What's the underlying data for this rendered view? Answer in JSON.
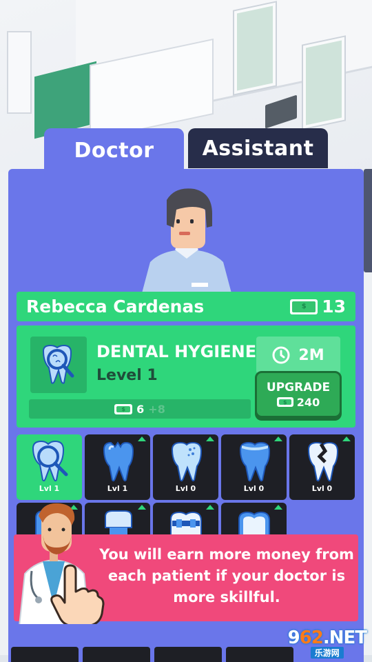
{
  "tabs": {
    "doctor": "Doctor",
    "assistant": "Assistant"
  },
  "doctor": {
    "name": "Rebecca Cardenas",
    "money": "13"
  },
  "skill": {
    "title": "DENTAL HYGIENE",
    "level": "Level 1",
    "time": "2M",
    "progress_value": "6",
    "progress_extra": "+8",
    "upgrade_label": "UPGRADE",
    "upgrade_cost": "240"
  },
  "skills_grid": [
    {
      "icon": "tooth-magnifier-icon",
      "level": "Lvl 1",
      "active": true
    },
    {
      "icon": "chipped-tooth-icon",
      "level": "Lvl 1",
      "active": false
    },
    {
      "icon": "cavity-tooth-icon",
      "level": "Lvl 0",
      "active": false
    },
    {
      "icon": "stained-tooth-icon",
      "level": "Lvl 0",
      "active": false
    },
    {
      "icon": "broken-tooth-icon",
      "level": "Lvl 0",
      "active": false
    },
    {
      "icon": "tooth-x-icon",
      "level": "",
      "active": false
    },
    {
      "icon": "crown-tooth-icon",
      "level": "",
      "active": false
    },
    {
      "icon": "braces-tooth-icon",
      "level": "",
      "active": false
    },
    {
      "icon": "tooth-cap-icon",
      "level": "",
      "active": false
    }
  ],
  "tutorial": {
    "text": "You will earn more money from each patient if your doctor is more skillful."
  },
  "watermark": {
    "main_a": "9",
    "main_b": "62",
    "main_c": ".NET",
    "sub": "乐游网"
  },
  "colors": {
    "panel": "#6a76ea",
    "green": "#2fd67b",
    "dark_tab": "#272d4a",
    "pink": "#f0497b"
  }
}
